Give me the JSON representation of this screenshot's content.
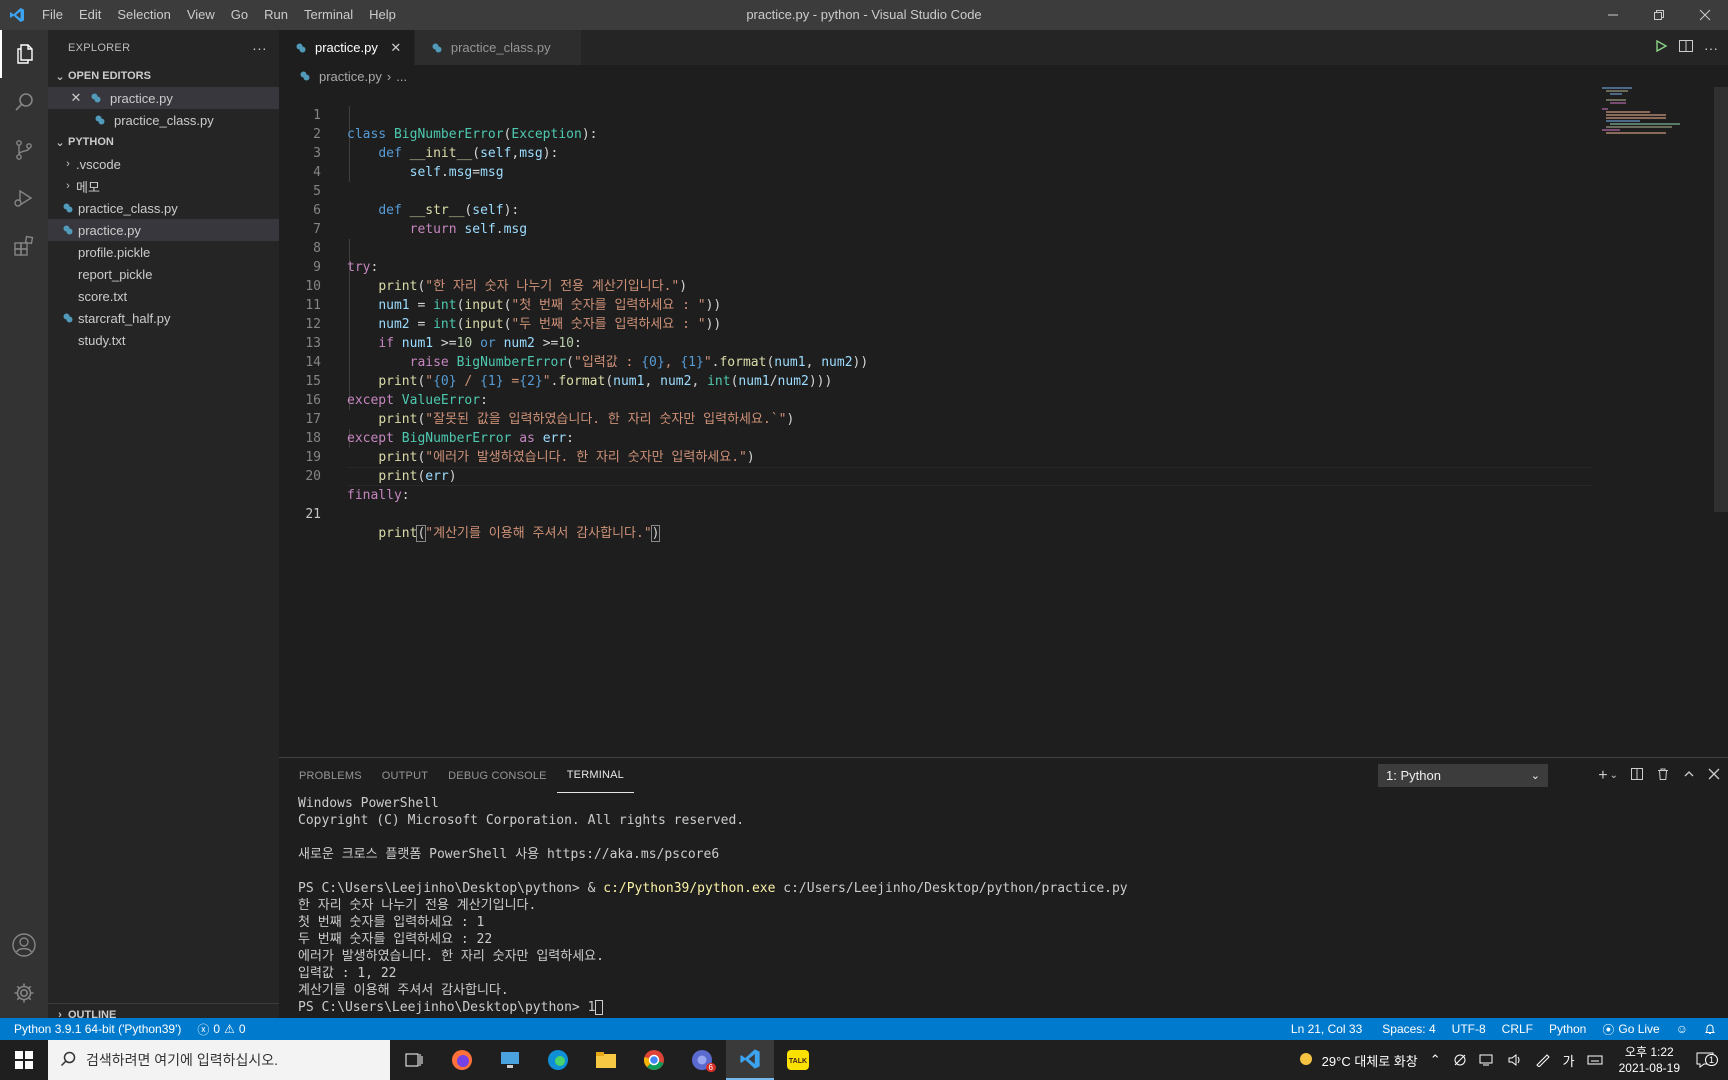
{
  "window": {
    "title": "practice.py - python - Visual Studio Code",
    "menu": [
      "File",
      "Edit",
      "Selection",
      "View",
      "Go",
      "Run",
      "Terminal",
      "Help"
    ]
  },
  "sidebar": {
    "header": "EXPLORER",
    "open_editors_label": "OPEN EDITORS",
    "open_editors": [
      "practice.py",
      "practice_class.py"
    ],
    "folder_label": "PYTHON",
    "items": [
      ".vscode",
      "메모",
      "practice_class.py",
      "practice.py",
      "profile.pickle",
      "report_pickle",
      "score.txt",
      "starcraft_half.py",
      "study.txt"
    ],
    "outline_label": "OUTLINE"
  },
  "tabs": [
    "practice.py",
    "practice_class.py"
  ],
  "breadcrumb": [
    "practice.py",
    "..."
  ],
  "code": {
    "line_numbers": [
      "1",
      "2",
      "3",
      "4",
      "5",
      "6",
      "7",
      "8",
      "9",
      "10",
      "11",
      "12",
      "13",
      "14",
      "15",
      "16",
      "17",
      "18",
      "19",
      "20",
      "21"
    ],
    "l1": [
      "class",
      "BigNumberError",
      "(",
      "Exception",
      "):"
    ],
    "l2": [
      "def",
      "__init__",
      "(",
      "self",
      ",",
      "msg",
      "):"
    ],
    "l3": [
      "self",
      ".",
      "msg",
      "=",
      "msg"
    ],
    "l5": [
      "def",
      "__str__",
      "(",
      "self",
      "):"
    ],
    "l6": [
      "return",
      "self",
      ".",
      "msg"
    ],
    "l8": [
      "try",
      ":"
    ],
    "l9": [
      "print",
      "(",
      "\"한 자리 숫자 나누기 전용 계산기입니다.\"",
      ")"
    ],
    "l10": [
      "num1",
      " = ",
      "int",
      "(",
      "input",
      "(",
      "\"첫 번째 숫자를 입력하세요 : \"",
      "))"
    ],
    "l11": [
      "num2",
      " = ",
      "int",
      "(",
      "input",
      "(",
      "\"두 번째 숫자를 입력하세요 : \"",
      "))"
    ],
    "l12": [
      "if",
      "num1",
      " >=",
      "10",
      " or ",
      "num2",
      " >=",
      "10",
      ":"
    ],
    "l13": [
      "raise",
      "BigNumberError",
      "(",
      "\"입력값 : ",
      "{0}",
      ", ",
      "{1}",
      "\"",
      ".",
      "format",
      "(",
      "num1",
      ", ",
      "num2",
      "))"
    ],
    "l14": [
      "print",
      "(",
      "\"",
      "{0}",
      " / ",
      "{1}",
      " =",
      "{2}",
      "\"",
      ".",
      "format",
      "(",
      "num1",
      ", ",
      "num2",
      ", ",
      "int",
      "(",
      "num1",
      "/",
      "num2",
      ")))"
    ],
    "l15": [
      "except",
      "ValueError",
      ":"
    ],
    "l16": [
      "print",
      "(",
      "\"잘못된 값을 입력하였습니다. 한 자리 숫자만 입력하세요.`\"",
      ")"
    ],
    "l17": [
      "except",
      "BigNumberError",
      " as ",
      "err",
      ":"
    ],
    "l18": [
      "print",
      "(",
      "\"에러가 발생하였습니다. 한 자리 숫자만 입력하세요.\"",
      ")"
    ],
    "l19": [
      "print",
      "(",
      "err",
      ")"
    ],
    "l20": [
      "finally",
      ":"
    ],
    "l21": [
      "print",
      "(",
      "\"계산기를 이용해 주셔서 감사합니다.\"",
      ")"
    ]
  },
  "panel": {
    "tabs": [
      "PROBLEMS",
      "OUTPUT",
      "DEBUG CONSOLE",
      "TERMINAL"
    ],
    "terminal_select": "1: Python",
    "terminal": {
      "l1": "Windows PowerShell",
      "l2": "Copyright (C) Microsoft Corporation. All rights reserved.",
      "l3": "새로운 크로스 플랫폼 PowerShell 사용 https://aka.ms/pscore6",
      "prompt": "PS C:\\Users\\Leejinho\\Desktop\\python> ",
      "cmd_amp": "& ",
      "cmd_exe": "c:/Python39/python.exe",
      "cmd_arg": " c:/Users/Leejinho/Desktop/python/practice.py",
      "o1": "한 자리 숫자 나누기 전용 계산기입니다.",
      "o2": "첫 번째 숫자를 입력하세요 : 1",
      "o3": "두 번째 숫자를 입력하세요 : 22",
      "o4": "에러가 발생하였습니다. 한 자리 숫자만 입력하세요.",
      "o5": "입력값 : 1, 22",
      "o6": "계산기를 이용해 주셔서 감사합니다.",
      "prompt2": "PS C:\\Users\\Leejinho\\Desktop\\python> ",
      "typed": "1"
    }
  },
  "status": {
    "interpreter": "Python 3.9.1 64-bit ('Python39')",
    "errors": "0",
    "warnings": "0",
    "position": "Ln 21, Col 33",
    "spaces": "Spaces: 4",
    "encoding": "UTF-8",
    "eol": "CRLF",
    "language": "Python",
    "golive": "Go Live"
  },
  "taskbar": {
    "search_placeholder": "검색하려면 여기에 입력하십시오.",
    "weather": "29°C 대체로 화창",
    "ime": "가",
    "time": "오후 1:22",
    "date": "2021-08-19",
    "chrome_badge": "6",
    "notif_count": "1"
  },
  "colors": {
    "accent": "#007acc",
    "editor_bg": "#1e1e1e",
    "sidebar_bg": "#252526",
    "activity_bg": "#333333",
    "python_icon": "#519aba"
  }
}
